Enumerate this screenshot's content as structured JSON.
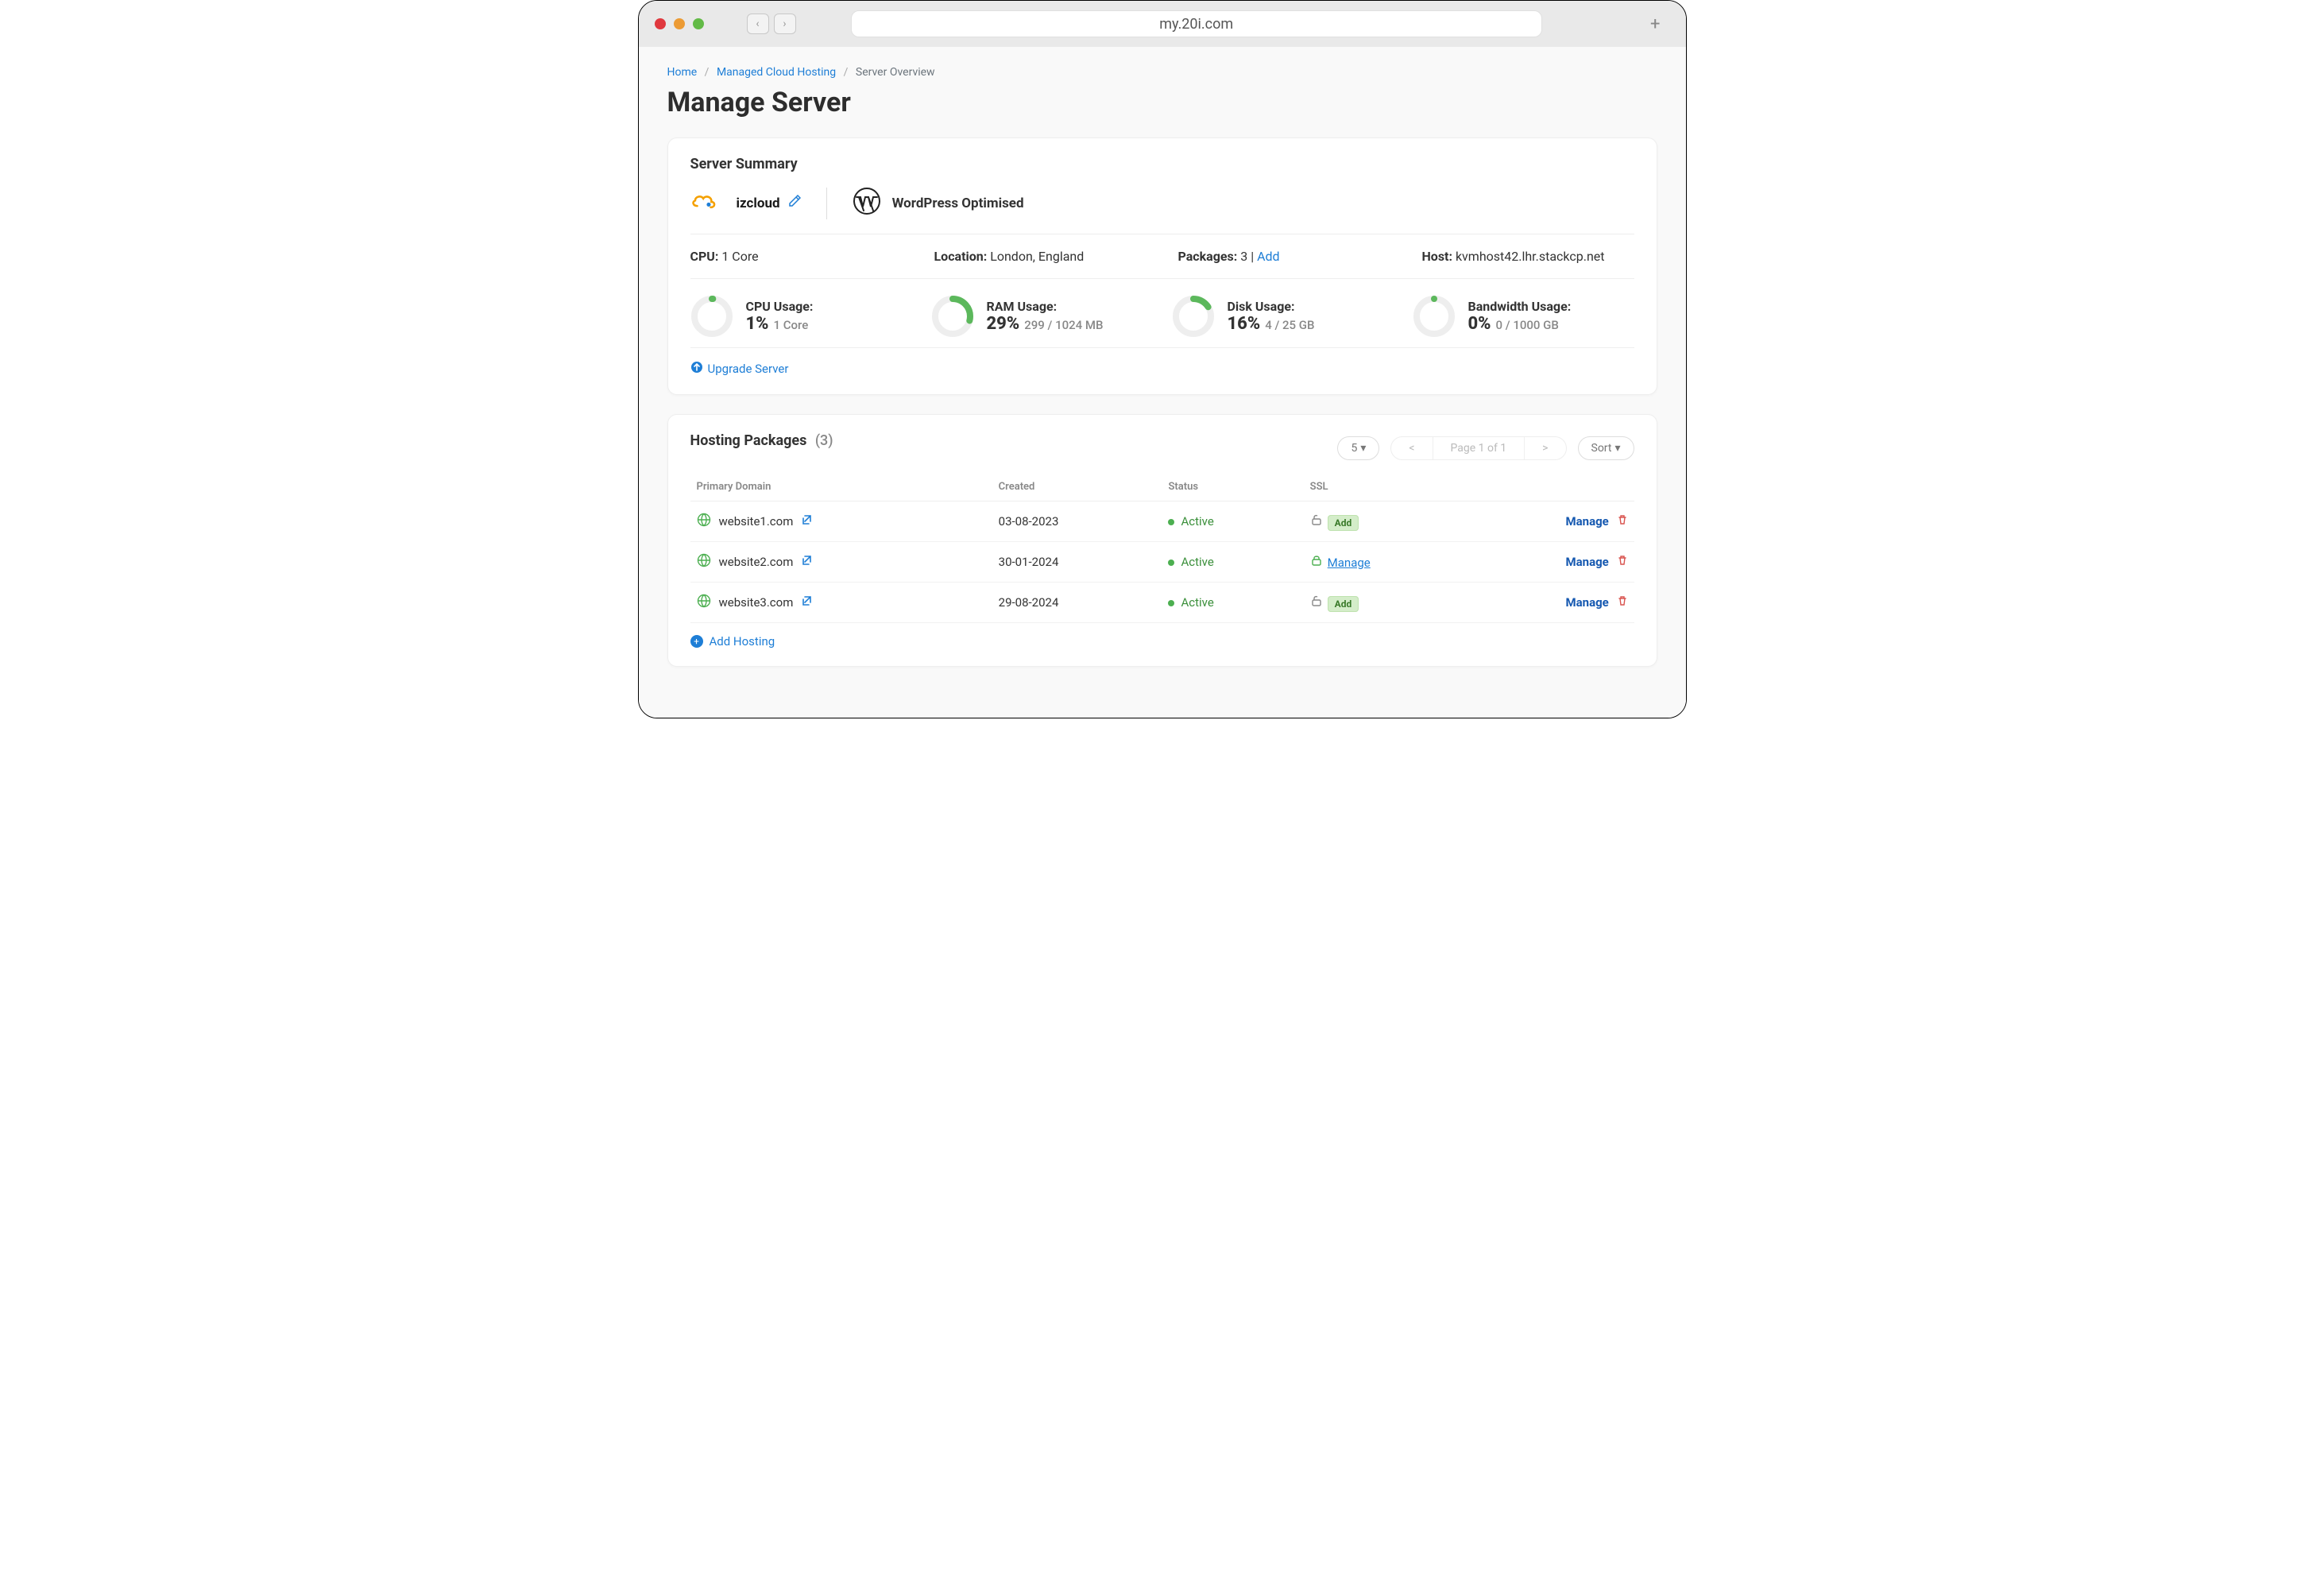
{
  "browser": {
    "url": "my.20i.com"
  },
  "breadcrumb": {
    "home": "Home",
    "managed": "Managed Cloud Hosting",
    "current": "Server Overview"
  },
  "page_title": "Manage Server",
  "summary": {
    "heading": "Server Summary",
    "server_name": "izcloud",
    "platform": "WordPress Optimised",
    "cpu_label": "CPU:",
    "cpu_value": "1 Core",
    "location_label": "Location:",
    "location_value": "London, England",
    "packages_label": "Packages:",
    "packages_value": "3",
    "packages_add": "Add",
    "host_label": "Host:",
    "host_value": "kvmhost42.lhr.stackcp.net"
  },
  "usage": {
    "cpu": {
      "label": "CPU Usage:",
      "pct": "1%",
      "sub": "1 Core",
      "value": 1
    },
    "ram": {
      "label": "RAM Usage:",
      "pct": "29%",
      "sub": "299 / 1024 MB",
      "value": 29
    },
    "disk": {
      "label": "Disk Usage:",
      "pct": "16%",
      "sub": "4 / 25 GB",
      "value": 16
    },
    "bw": {
      "label": "Bandwidth Usage:",
      "pct": "0%",
      "sub": "0 / 1000 GB",
      "value": 0
    }
  },
  "upgrade_link": "Upgrade Server",
  "packages": {
    "heading": "Hosting Packages",
    "count": "(3)",
    "page_size": "5",
    "page_info": "Page 1 of  1",
    "sort": "Sort",
    "cols": {
      "domain": "Primary Domain",
      "created": "Created",
      "status": "Status",
      "ssl": "SSL"
    },
    "rows": [
      {
        "domain": "website1.com",
        "created": "03-08-2023",
        "status": "Active",
        "ssl": "add",
        "manage": "Manage"
      },
      {
        "domain": "website2.com",
        "created": "30-01-2024",
        "status": "Active",
        "ssl": "manage",
        "manage": "Manage"
      },
      {
        "domain": "website3.com",
        "created": "29-08-2024",
        "status": "Active",
        "ssl": "add",
        "manage": "Manage"
      }
    ],
    "ssl_add_label": "Add",
    "ssl_manage_label": "Manage",
    "add_hosting": "Add Hosting"
  }
}
